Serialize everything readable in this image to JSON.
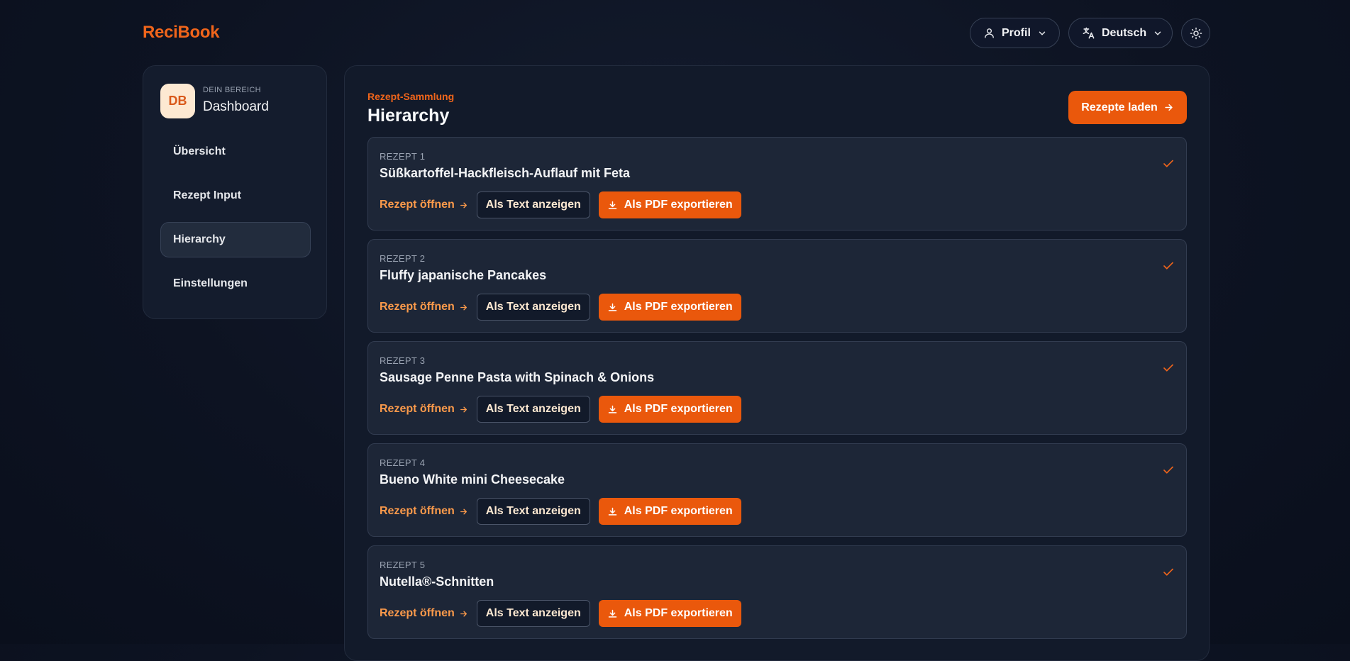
{
  "app": {
    "logo": "ReciBook"
  },
  "header": {
    "profile_label": "Profil",
    "language_label": "Deutsch"
  },
  "sidebar": {
    "avatar_initials": "DB",
    "area_label": "DEIN BEREICH",
    "area_title": "Dashboard",
    "items": [
      {
        "label": "Übersicht",
        "active": false
      },
      {
        "label": "Rezept Input",
        "active": false
      },
      {
        "label": "Hierarchy",
        "active": true
      },
      {
        "label": "Einstellungen",
        "active": false
      }
    ]
  },
  "main": {
    "eyebrow": "Rezept-Sammlung",
    "title": "Hierarchy",
    "load_button": "Rezepte laden",
    "recipes": [
      {
        "number": "REZEPT 1",
        "title": "Süßkartoffel-Hackfleisch-Auflauf mit Feta"
      },
      {
        "number": "REZEPT 2",
        "title": "Fluffy japanische Pancakes"
      },
      {
        "number": "REZEPT 3",
        "title": "Sausage Penne Pasta with Spinach & Onions"
      },
      {
        "number": "REZEPT 4",
        "title": "Bueno White mini Cheesecake"
      },
      {
        "number": "REZEPT 5",
        "title": "Nutella®-Schnitten"
      }
    ],
    "actions": {
      "open": "Rezept öffnen",
      "text": "Als Text anzeigen",
      "pdf": "Als PDF exportieren"
    }
  },
  "colors": {
    "accent": "#ea580c",
    "accent_text": "#fb9a4b",
    "background": "#0d1322",
    "card": "#1d2637"
  }
}
